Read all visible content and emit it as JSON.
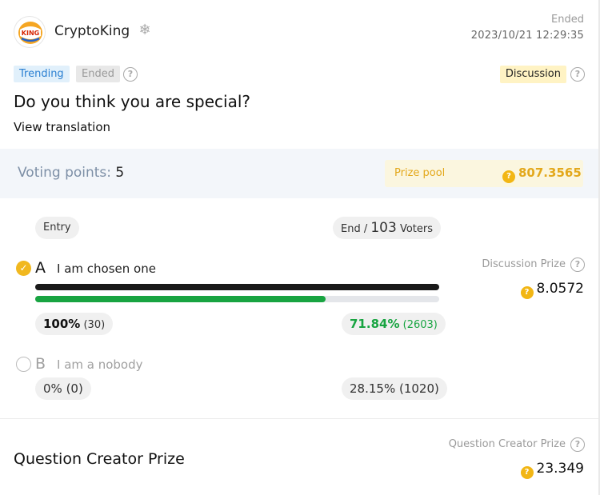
{
  "header": {
    "username": "CryptoKing",
    "avatar_icon": "burger-king-logo",
    "avatar_text": "KING",
    "verified_icon": "snowflake-badge-icon",
    "status": "Ended",
    "timestamp": "2023/10/21 12:29:35"
  },
  "tags": {
    "trending": "Trending",
    "ended": "Ended",
    "discussion": "Discussion",
    "help": "?"
  },
  "question": {
    "title": "Do you think you are special?",
    "translate_link": "View translation"
  },
  "voting": {
    "label": "Voting points:",
    "points": "5",
    "prize_pool_label": "Prize pool",
    "prize_pool_value": "807.3565"
  },
  "pills": {
    "entry": "Entry",
    "end_prefix": "End /",
    "voters_count": "103",
    "voters_suffix": "Voters"
  },
  "options": [
    {
      "letter": "A",
      "label": "I am chosen one",
      "selected": true,
      "entry_percent": "100%",
      "entry_count": "(30)",
      "end_percent": "71.84%",
      "end_count": "(2603)",
      "fill_fraction": 0.7184
    },
    {
      "letter": "B",
      "label": "I am a nobody",
      "selected": false,
      "entry_text": "0% (0)",
      "end_text": "28.15% (1020)"
    }
  ],
  "discussion_prize": {
    "label": "Discussion Prize",
    "value": "8.0572"
  },
  "creator_prize": {
    "title": "Question Creator Prize",
    "label": "Question Creator Prize",
    "value": "23.349"
  },
  "colors": {
    "accent_green": "#18a441",
    "coin_gold": "#f2b614",
    "trending_blue": "#2a7fd1"
  }
}
